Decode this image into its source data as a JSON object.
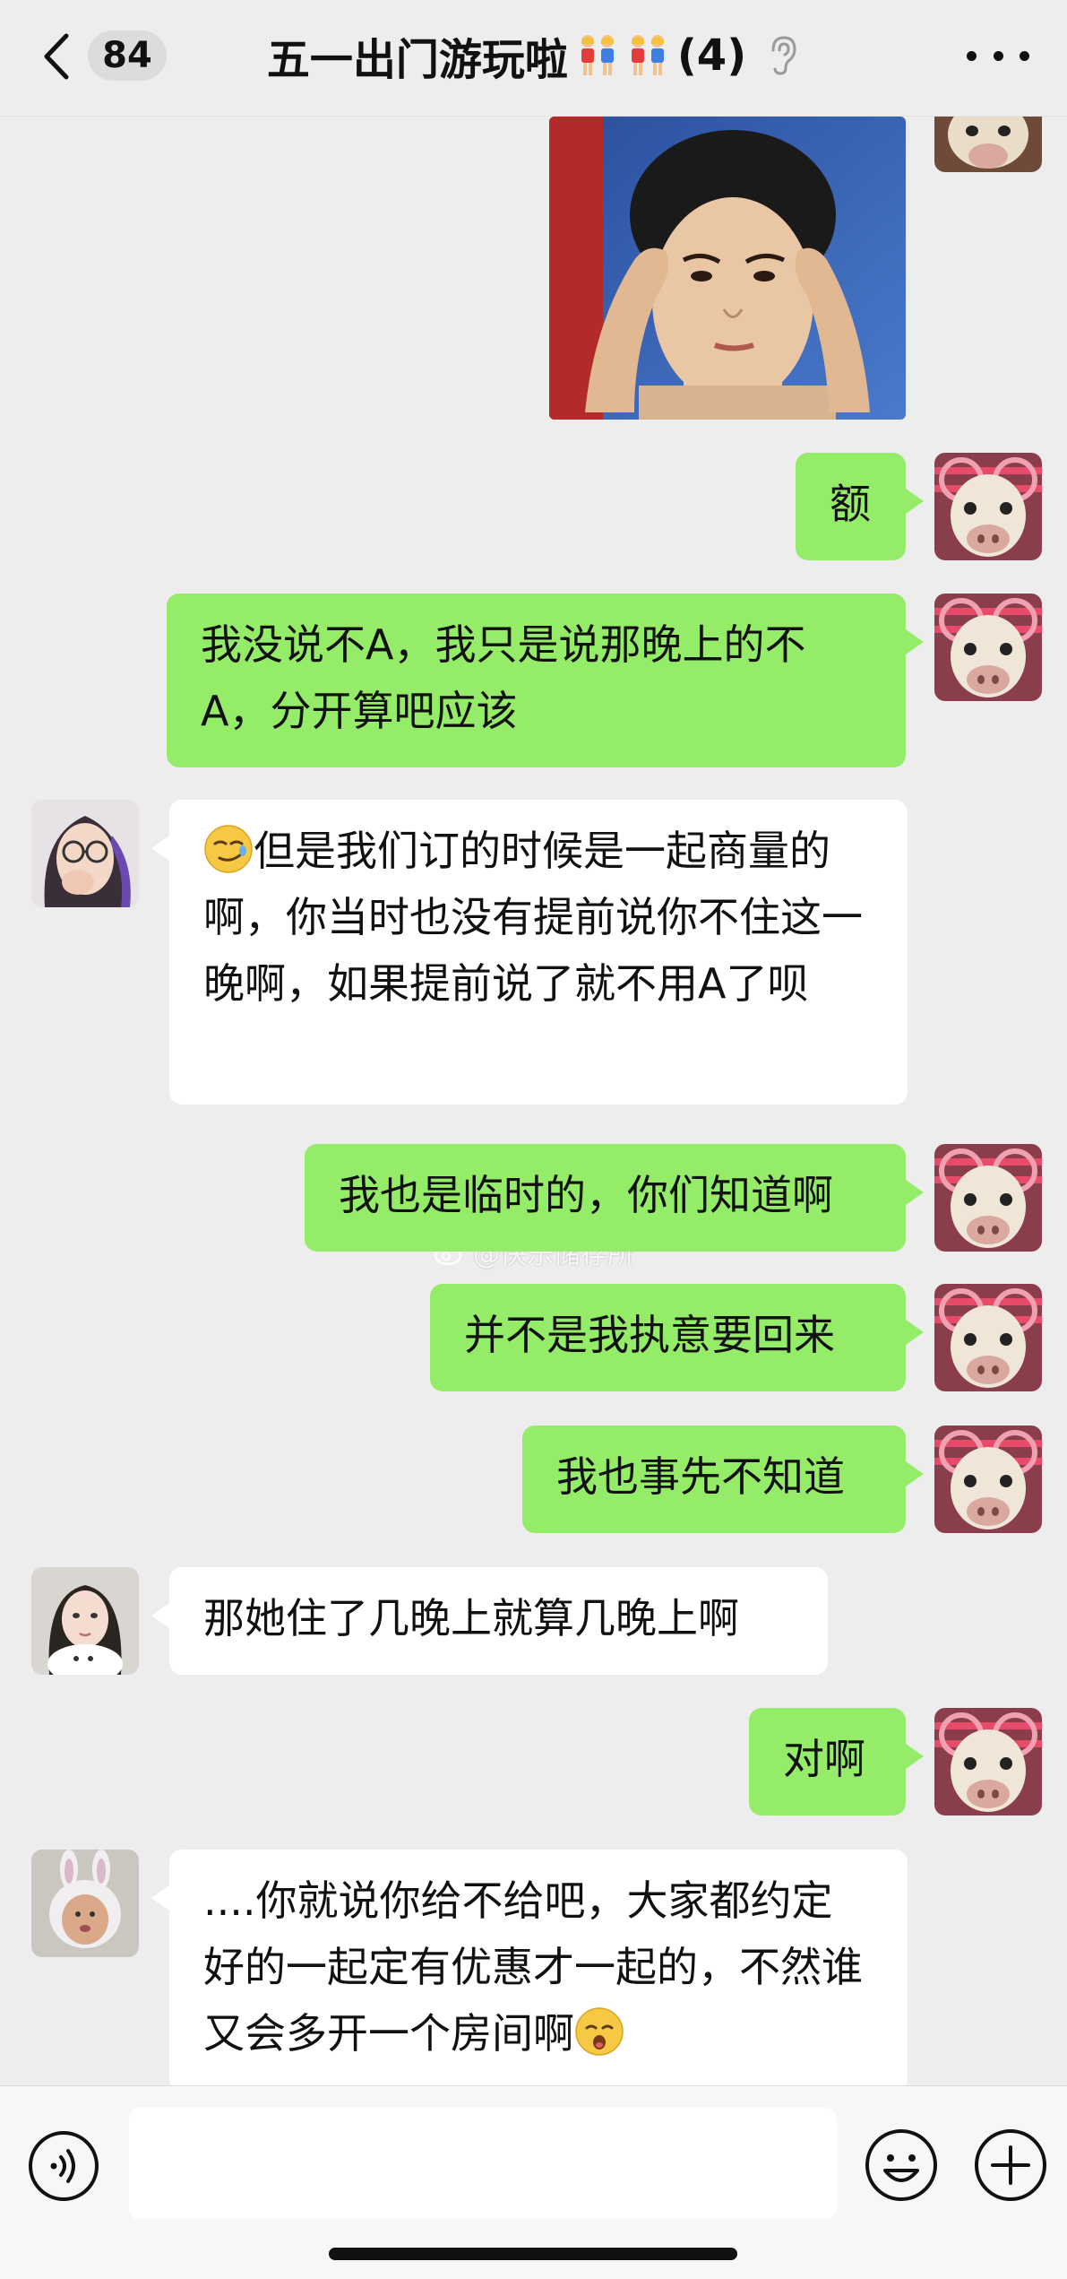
{
  "header": {
    "back_count": "84",
    "title": "五一出门游玩啦",
    "member_count": "(4)"
  },
  "colors": {
    "background": "#ededed",
    "bubble_self": "#95ec69",
    "bubble_other": "#ffffff"
  },
  "messages": [
    {
      "id": "m1",
      "sender": "self",
      "type": "image"
    },
    {
      "id": "m2",
      "sender": "self",
      "text": "额"
    },
    {
      "id": "m3",
      "sender": "self",
      "text": "我没说不A，我只是说那晚上的不A，分开算吧应该"
    },
    {
      "id": "m4",
      "sender": "member_glasses",
      "text": "但是我们订的时候是一起商量的啊，你当时也没有提前说你不住这一晚啊，如果提前说了就不用A了呗",
      "leading_emoji": "smirk-emoji"
    },
    {
      "id": "m5",
      "sender": "self",
      "text": "我也是临时的，你们知道啊"
    },
    {
      "id": "m6",
      "sender": "self",
      "text": "并不是我执意要回来"
    },
    {
      "id": "m7",
      "sender": "self",
      "text": "我也事先不知道"
    },
    {
      "id": "m8",
      "sender": "member_cat",
      "text": "那她住了几晚上就算几晚上啊"
    },
    {
      "id": "m9",
      "sender": "self",
      "text": "对啊"
    },
    {
      "id": "m10",
      "sender": "member_bunny",
      "text": "....你就说你给不给吧，大家都约定好的一起定有优惠才一起的，不然谁又会多开一个房间啊",
      "trailing_emoji": "pouting-emoji"
    }
  ],
  "watermark": "@快乐储存所",
  "input": {
    "placeholder": "",
    "value": ""
  },
  "icons": {
    "back": "chevron-left-icon",
    "mute": "ear-icon",
    "more": "more-dots-icon",
    "voice": "voice-icon",
    "emoji": "smiley-icon",
    "plus": "plus-icon"
  }
}
